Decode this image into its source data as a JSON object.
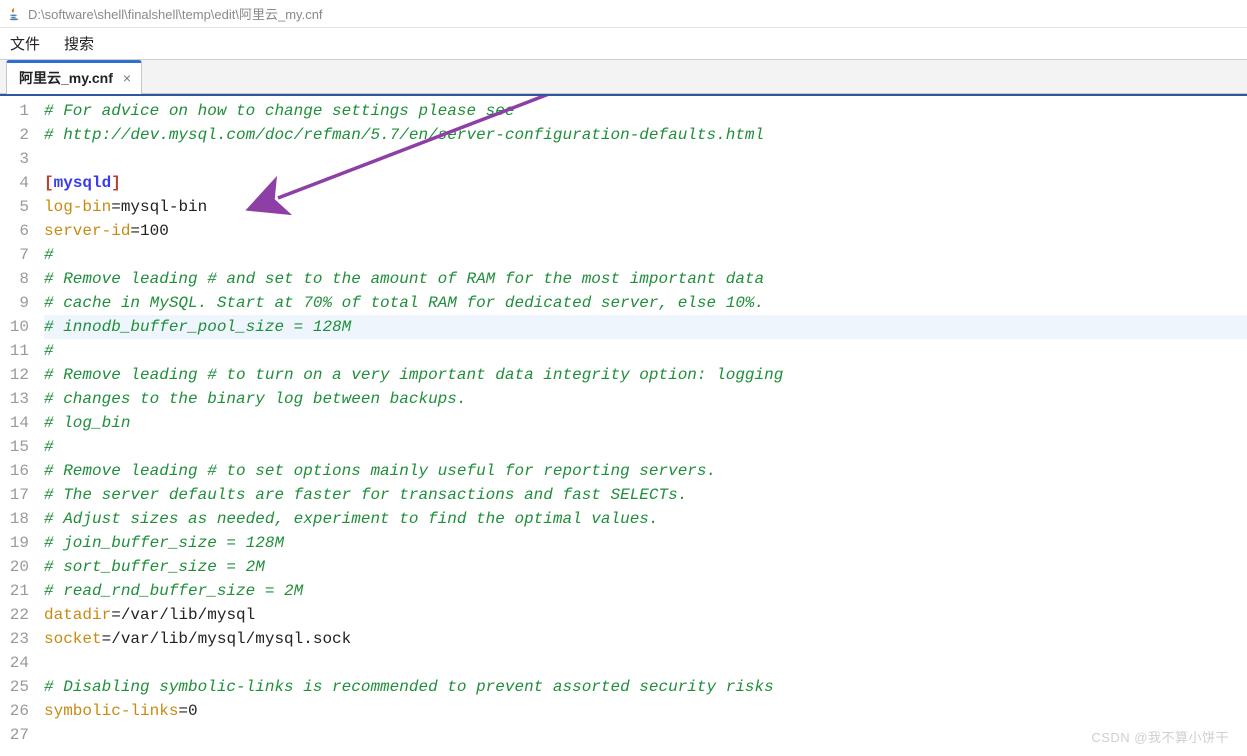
{
  "window": {
    "title_path": "D:\\software\\shell\\finalshell\\temp\\edit\\阿里云_my.cnf"
  },
  "menu": {
    "file": "文件",
    "search": "搜索"
  },
  "tab": {
    "label": "阿里云_my.cnf",
    "close": "×"
  },
  "highlighted_line": 10,
  "code_lines": [
    {
      "type": "comment",
      "text": "# For advice on how to change settings please see"
    },
    {
      "type": "comment",
      "text": "# http://dev.mysql.com/doc/refman/5.7/en/server-configuration-defaults.html"
    },
    {
      "type": "blank",
      "text": ""
    },
    {
      "type": "section",
      "name": "mysqld"
    },
    {
      "type": "kv",
      "key": "log-bin",
      "val": "mysql-bin"
    },
    {
      "type": "kv",
      "key": "server-id",
      "val": "100"
    },
    {
      "type": "comment",
      "text": "#"
    },
    {
      "type": "comment",
      "text": "# Remove leading # and set to the amount of RAM for the most important data"
    },
    {
      "type": "comment",
      "text": "# cache in MySQL. Start at 70% of total RAM for dedicated server, else 10%."
    },
    {
      "type": "comment",
      "text": "# innodb_buffer_pool_size = 128M"
    },
    {
      "type": "comment",
      "text": "#"
    },
    {
      "type": "comment",
      "text": "# Remove leading # to turn on a very important data integrity option: logging"
    },
    {
      "type": "comment",
      "text": "# changes to the binary log between backups."
    },
    {
      "type": "comment",
      "text": "# log_bin"
    },
    {
      "type": "comment",
      "text": "#"
    },
    {
      "type": "comment",
      "text": "# Remove leading # to set options mainly useful for reporting servers."
    },
    {
      "type": "comment",
      "text": "# The server defaults are faster for transactions and fast SELECTs."
    },
    {
      "type": "comment",
      "text": "# Adjust sizes as needed, experiment to find the optimal values."
    },
    {
      "type": "comment",
      "text": "# join_buffer_size = 128M"
    },
    {
      "type": "comment",
      "text": "# sort_buffer_size = 2M"
    },
    {
      "type": "comment",
      "text": "# read_rnd_buffer_size = 2M"
    },
    {
      "type": "kv",
      "key": "datadir",
      "val": "/var/lib/mysql"
    },
    {
      "type": "kv",
      "key": "socket",
      "val": "/var/lib/mysql/mysql.sock"
    },
    {
      "type": "blank",
      "text": ""
    },
    {
      "type": "comment",
      "text": "# Disabling symbolic-links is recommended to prevent assorted security risks"
    },
    {
      "type": "kv",
      "key": "symbolic-links",
      "val": "0"
    },
    {
      "type": "blank",
      "text": ""
    }
  ],
  "watermark": "CSDN @我不算小饼干"
}
